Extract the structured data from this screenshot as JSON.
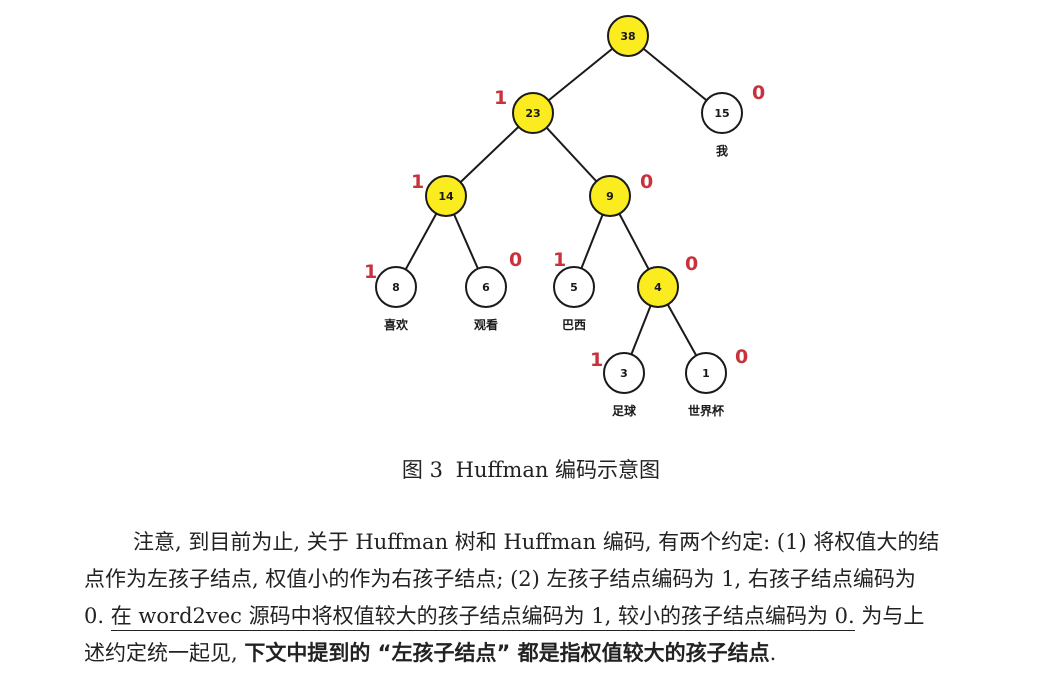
{
  "figure": {
    "colors": {
      "highlight": "#fbec20",
      "plain": "#ffffff",
      "code": "#c8323c",
      "stroke": "#1a1a1a"
    },
    "nodes": [
      {
        "id": "n38",
        "value": "38",
        "highlight": true,
        "word": "",
        "code": ""
      },
      {
        "id": "n23",
        "value": "23",
        "highlight": true,
        "word": "",
        "code": "1"
      },
      {
        "id": "n15",
        "value": "15",
        "highlight": false,
        "word": "我",
        "code": "0"
      },
      {
        "id": "n14",
        "value": "14",
        "highlight": true,
        "word": "",
        "code": "1"
      },
      {
        "id": "n9",
        "value": "9",
        "highlight": true,
        "word": "",
        "code": "0"
      },
      {
        "id": "n8",
        "value": "8",
        "highlight": false,
        "word": "喜欢",
        "code": "1"
      },
      {
        "id": "n6",
        "value": "6",
        "highlight": false,
        "word": "观看",
        "code": "0"
      },
      {
        "id": "n5",
        "value": "5",
        "highlight": false,
        "word": "巴西",
        "code": "1"
      },
      {
        "id": "n4",
        "value": "4",
        "highlight": true,
        "word": "",
        "code": "0"
      },
      {
        "id": "n3",
        "value": "3",
        "highlight": false,
        "word": "足球",
        "code": "1"
      },
      {
        "id": "n1",
        "value": "1",
        "highlight": false,
        "word": "世界杯",
        "code": "0"
      }
    ],
    "edges": [
      [
        "n38",
        "n23"
      ],
      [
        "n38",
        "n15"
      ],
      [
        "n23",
        "n14"
      ],
      [
        "n23",
        "n9"
      ],
      [
        "n14",
        "n8"
      ],
      [
        "n14",
        "n6"
      ],
      [
        "n9",
        "n5"
      ],
      [
        "n9",
        "n4"
      ],
      [
        "n4",
        "n3"
      ],
      [
        "n4",
        "n1"
      ]
    ]
  },
  "caption": {
    "label": "图 3",
    "text": "Huffman 编码示意图"
  },
  "paragraph": {
    "line1": "注意, 到目前为止, 关于 Huffman 树和 Huffman 编码, 有两个约定: (1) 将权值大的结",
    "line2": "点作为左孩子结点, 权值小的作为右孩子结点; (2) 左孩子结点编码为 1, 右孩子结点编码为",
    "line3_start": "0.",
    "line3_underlined": "在 word2vec 源码中将权值较大的孩子结点编码为 1, 较小的孩子结点编码为 0.",
    "line3_end": "为与上",
    "line4_start": "述约定统一起见,",
    "line4_bold": "下文中提到的 “左孩子结点” 都是指权值较大的孩子结点",
    "line4_end": "."
  }
}
